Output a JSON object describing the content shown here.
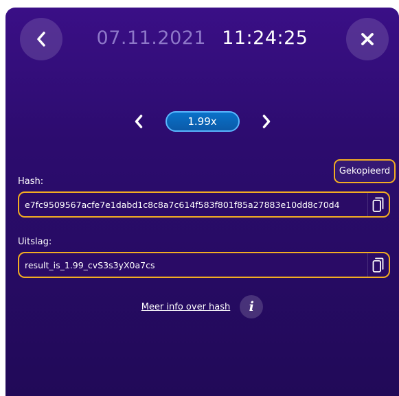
{
  "header": {
    "back_icon": "chevron-left-icon",
    "close_icon": "close-icon",
    "date": "07.11.2021",
    "time": "11:24:25"
  },
  "multiplier": {
    "value": "1.99x",
    "prev_icon": "chevron-left-icon",
    "next_icon": "chevron-right-icon"
  },
  "copied_badge": "Gekopieerd",
  "hash": {
    "label": "Hash:",
    "value": "e7fc9509567acfe7e1dabd1c8c8a7c614f583f801f85a27883e10dd8c70d4",
    "copy_icon": "copy-icon"
  },
  "result": {
    "label": "Uitslag:",
    "value": "result_is_1.99_cvS3s3yX0a7cs",
    "copy_icon": "copy-icon"
  },
  "info": {
    "link_text": "Meer info over hash",
    "icon_glyph": "i"
  },
  "colors": {
    "background_top": "#3a0f86",
    "background_bottom": "#210a58",
    "accent_orange": "#f3ad22",
    "pill_blue": "#0a71c9",
    "date_muted": "#8e78c9"
  }
}
